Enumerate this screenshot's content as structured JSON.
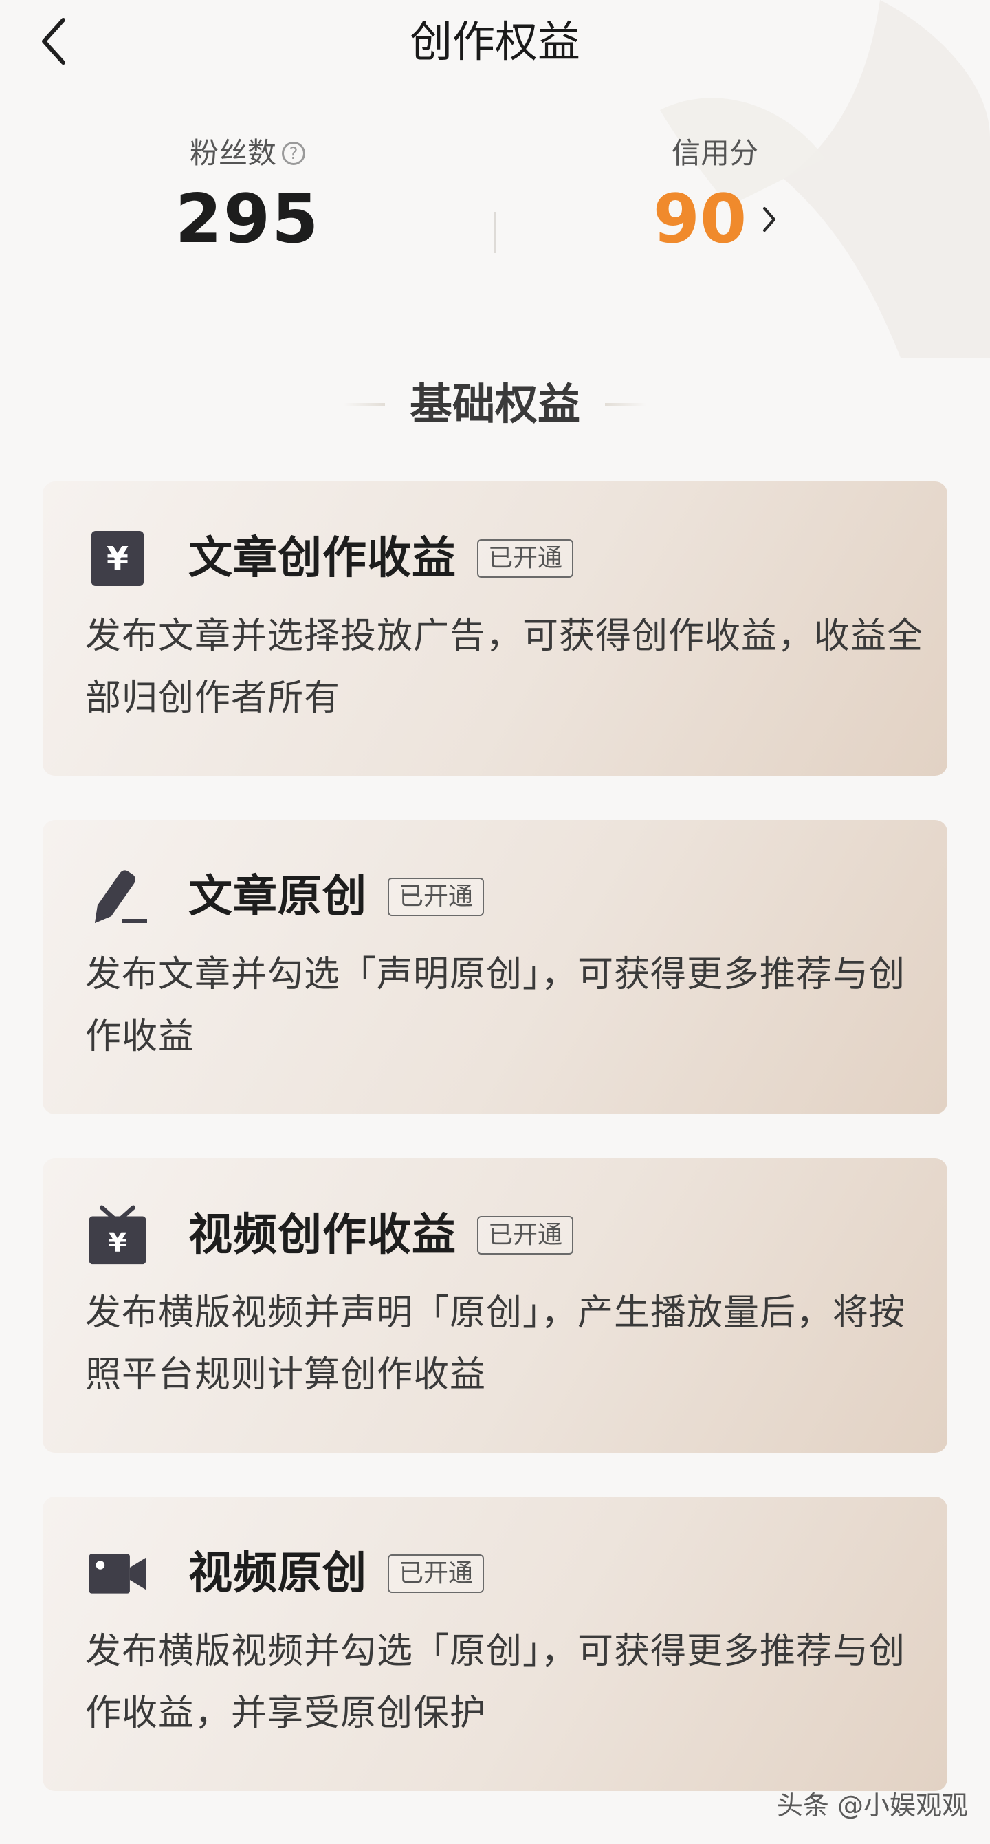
{
  "header": {
    "title": "创作权益"
  },
  "stats": {
    "fans": {
      "label": "粉丝数",
      "value": "295"
    },
    "credit": {
      "label": "信用分",
      "value": "90",
      "value_color": "#f08a2c"
    }
  },
  "section": {
    "title": "基础权益"
  },
  "cards": [
    {
      "icon": "yuan-icon",
      "title": "文章创作收益",
      "badge": "已开通",
      "desc": "发布文章并选择投放广告，可获得创作收益，收益全部归创作者所有"
    },
    {
      "icon": "pen-icon",
      "title": "文章原创",
      "badge": "已开通",
      "desc": "发布文章并勾选「声明原创」，可获得更多推荐与创作收益"
    },
    {
      "icon": "tv-yuan-icon",
      "title": "视频创作收益",
      "badge": "已开通",
      "desc": "发布横版视频并声明「原创」，产生播放量后，将按照平台规则计算创作收益"
    },
    {
      "icon": "video-camera-icon",
      "title": "视频原创",
      "badge": "已开通",
      "desc": "发布横版视频并勾选「原创」，可获得更多推荐与创作收益，并享受原创保护"
    }
  ],
  "watermark": "头条 @小娱观观"
}
